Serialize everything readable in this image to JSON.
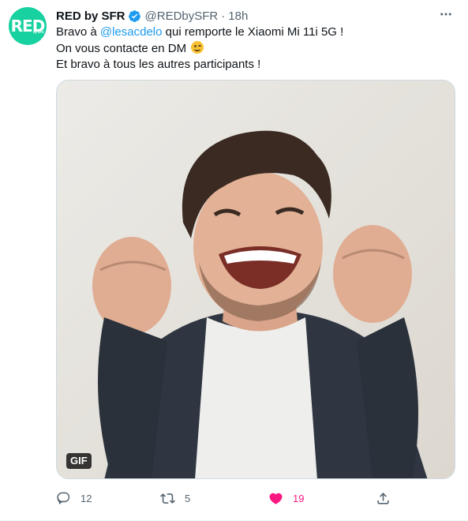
{
  "tweet": {
    "avatar": {
      "logo_text": "RED",
      "logo_subtext": "by SFR",
      "color": "#17d1a0"
    },
    "author_name": "RED by SFR",
    "verified": true,
    "handle": "@REDbySFR",
    "separator": "·",
    "time": "18h",
    "more_icon": "ellipsis-icon",
    "text": {
      "line1_pre": "Bravo à ",
      "line1_mention": "@lesacdelo",
      "line1_post": " qui remporte le Xiaomi Mi 11i 5G  !",
      "line2": "On vous contacte en DM",
      "line2_emoji": "winking-face-emoji",
      "line3": "Et bravo à tous les autres participants !"
    },
    "media": {
      "type": "gif",
      "badge": "GIF"
    },
    "actions": {
      "reply": {
        "icon": "reply-icon",
        "count": "12"
      },
      "retweet": {
        "icon": "retweet-icon",
        "count": "5"
      },
      "like": {
        "icon": "heart-icon",
        "count": "19",
        "active": true,
        "color": "#f91880"
      },
      "share": {
        "icon": "share-icon"
      }
    }
  },
  "colors": {
    "accent": "#1d9bf0",
    "muted": "#536471",
    "text": "#0f1419"
  }
}
